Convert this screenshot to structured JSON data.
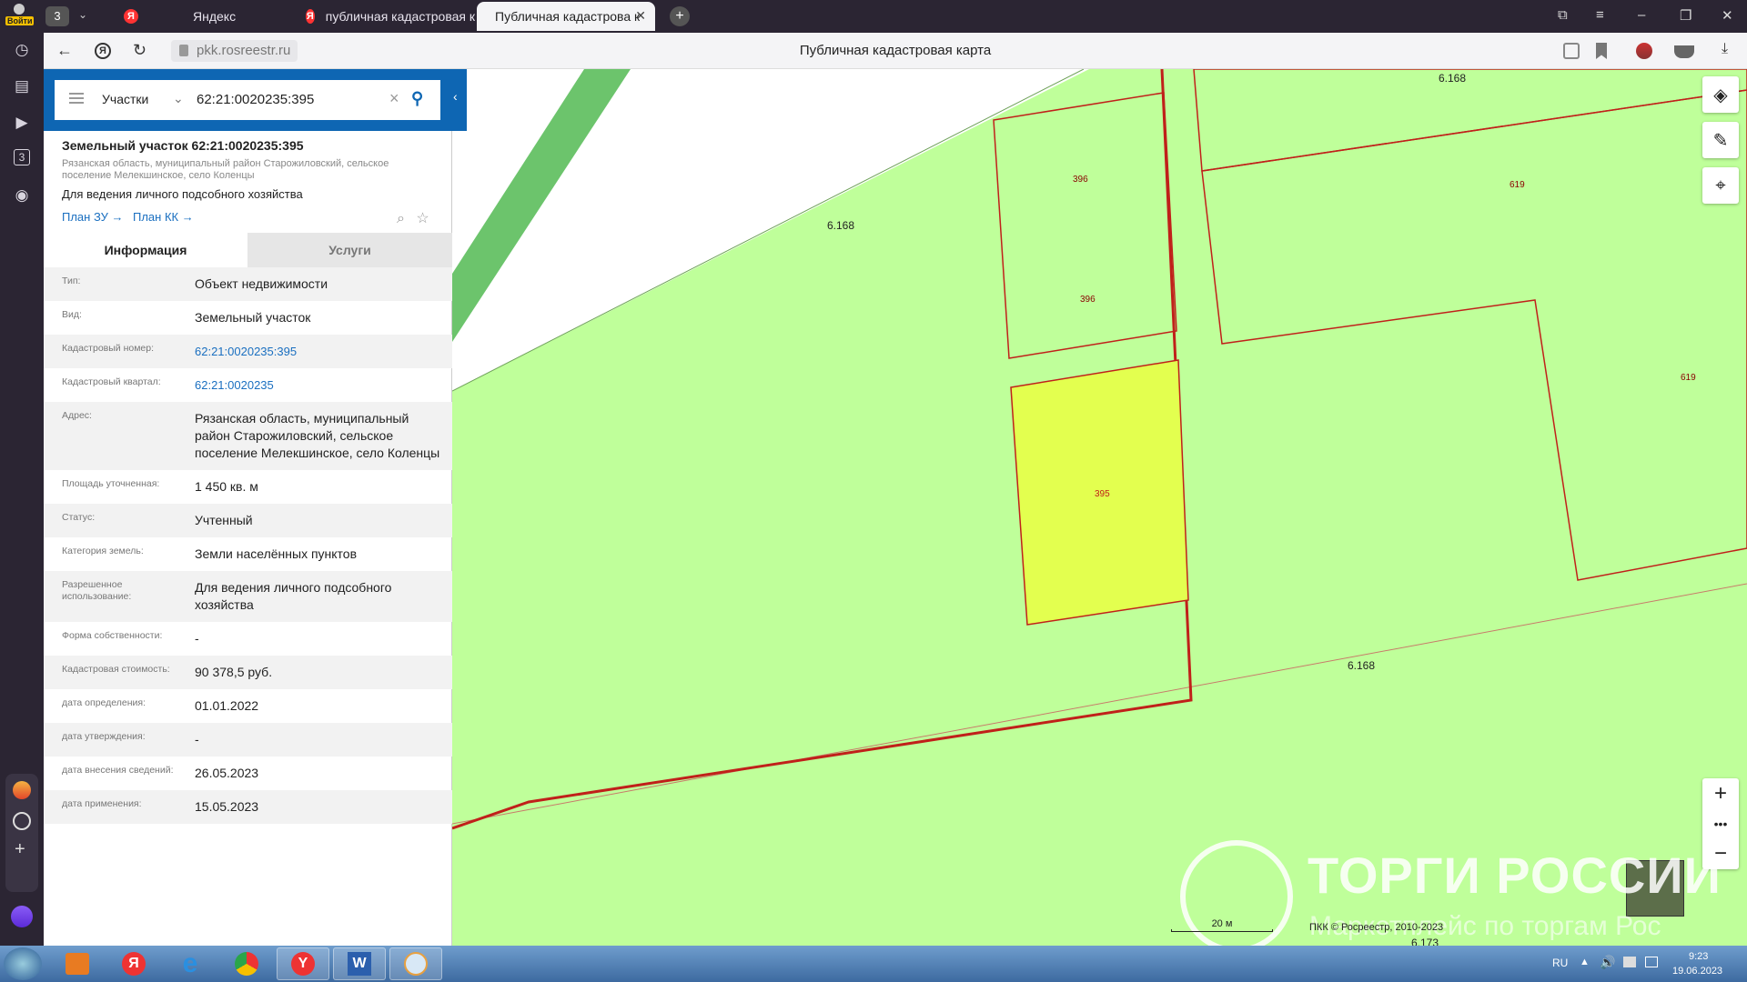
{
  "browser": {
    "tab_count": "3",
    "login_label": "Войти",
    "tabs": [
      {
        "label": "Яндекс"
      },
      {
        "label": "публичная кадастровая к"
      },
      {
        "label": "Публичная кадастрова к"
      }
    ],
    "url": "pkk.rosreestr.ru",
    "page_title": "Публичная кадастровая карта"
  },
  "search": {
    "type": "Участки",
    "value": "62:21:0020235:395"
  },
  "parcel": {
    "title": "Земельный участок 62:21:0020235:395",
    "address": "Рязанская область, муниципальный район Старожиловский, сельское поселение Мелекшинское, село Коленцы",
    "use": "Для ведения личного подсобного хозяйства",
    "plan_zu": "План ЗУ →",
    "plan_kk": "План КК →"
  },
  "tabs": {
    "info": "Информация",
    "services": "Услуги"
  },
  "rows": [
    {
      "label": "Тип:",
      "value": "Объект недвижимости"
    },
    {
      "label": "Вид:",
      "value": "Земельный участок"
    },
    {
      "label": "Кадастровый номер:",
      "value": "62:21:0020235:395"
    },
    {
      "label": "Кадастровый квартал:",
      "value": "62:21:0020235"
    },
    {
      "label": "Адрес:",
      "value": "Рязанская область, муниципальный район Старожиловский, сельское поселение Мелекшинское, село Коленцы"
    },
    {
      "label": "Площадь уточненная:",
      "value": "1 450 кв. м"
    },
    {
      "label": "Статус:",
      "value": "Учтенный"
    },
    {
      "label": "Категория земель:",
      "value": "Земли населённых пунктов"
    },
    {
      "label": "Разрешенное использование:",
      "value": "Для ведения личного подсобного хозяйства"
    },
    {
      "label": "Форма собственности:",
      "value": "-"
    },
    {
      "label": "Кадастровая стоимость:",
      "value": "90 378,5 руб."
    },
    {
      "label": "дата определения:",
      "value": "01.01.2022"
    },
    {
      "label": "дата утверждения:",
      "value": "-"
    },
    {
      "label": "дата внесения сведений:",
      "value": "26.05.2023"
    },
    {
      "label": "дата применения:",
      "value": "15.05.2023"
    }
  ],
  "map": {
    "labels": {
      "zone_a": "6.168",
      "zone_b": "6.168",
      "zone_c": "6.168",
      "zone_d": "6.173",
      "p396a": "396",
      "p396b": "396",
      "p395": "395",
      "p619a": "619",
      "p619b": "619"
    },
    "scale": "20 м",
    "copyright": "ПКК © Росреестр, 2010-2023",
    "colors": {
      "land": "#bfff9a",
      "selected": "#e3ff4f",
      "border": "#c0201a",
      "forest": "#6cc46c"
    }
  },
  "watermark": {
    "title": "ТОРГИ РОССИИ",
    "subtitle": "Маркетплейс по торгам Рос"
  },
  "taskbar": {
    "lang": "RU",
    "time": "9:23",
    "date": "19.06.2023"
  }
}
